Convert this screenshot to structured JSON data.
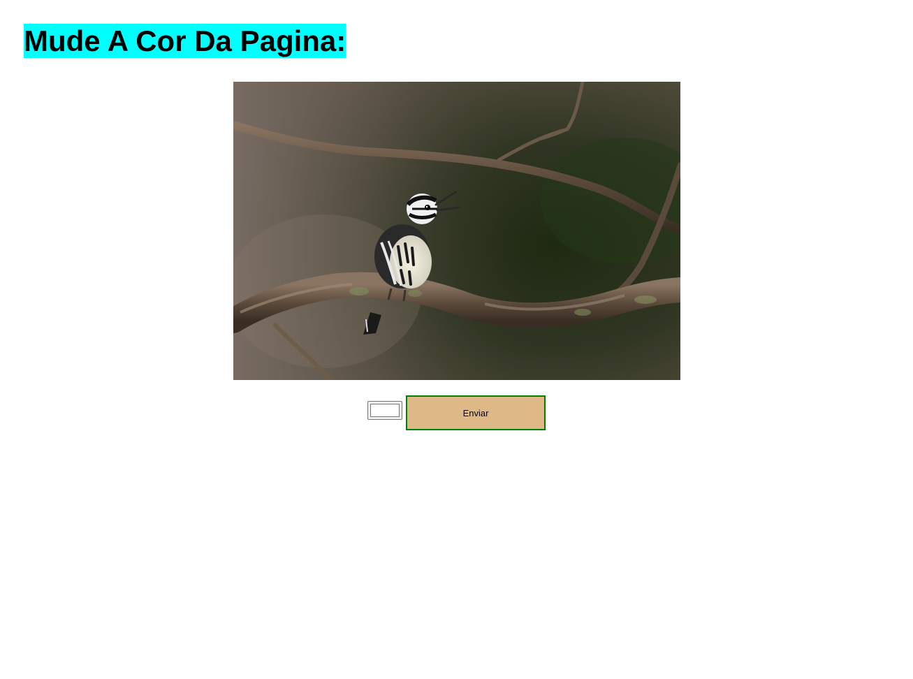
{
  "header": {
    "title": "Mude A Cor Da Pagina:"
  },
  "photo": {
    "subject": "black-and-white warbler singing on a branch"
  },
  "form": {
    "color_value": "#ffffff",
    "submit_label": "Enviar"
  },
  "colors": {
    "title_highlight": "#00ffff",
    "button_background": "#deb887",
    "button_border": "#008000",
    "page_background": "#ffffff"
  }
}
